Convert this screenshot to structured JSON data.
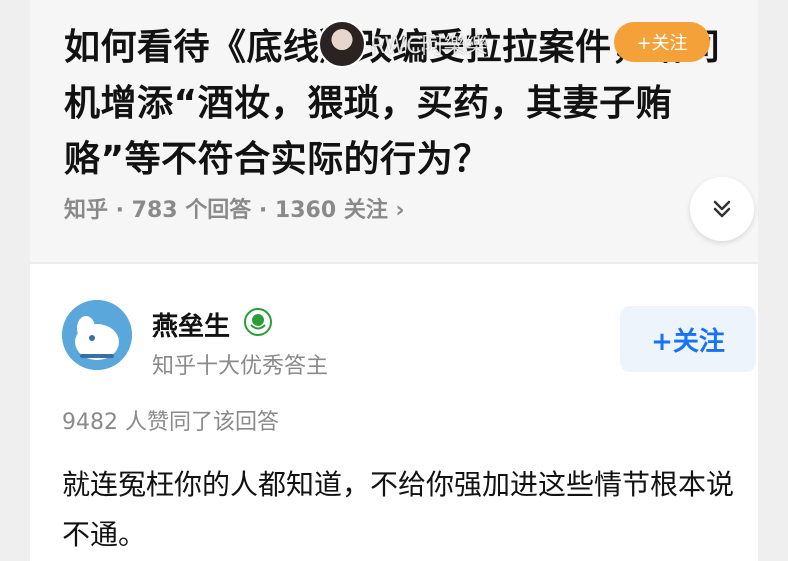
{
  "question": {
    "title": "如何看待《底线》改编受拉拉案件，给司机增添“酒妆，猥琐，买药，其妻子贿赂”等不符合实际的行为？",
    "meta": "知乎 · 783 个回答 · 1360 关注 ›"
  },
  "overlay": {
    "username": "RWC阿樂樂",
    "follow_label": "+关注"
  },
  "answer": {
    "author_name": "燕垒生",
    "author_title": "知乎十大优秀答主",
    "follow_label": "+关注",
    "upvote_text": "9482 人赞同了该回答",
    "body": "就连冤枉你的人都知道，不给你强加进这些情节根本说不通。"
  },
  "icons": {
    "expand": "chevron-double-down-icon",
    "badge": "laurel-badge-icon"
  },
  "colors": {
    "primary_blue": "#1772f6",
    "overlay_orange": "#f5a13a",
    "text": "#121212",
    "meta_gray": "#8a8a8a",
    "badge_green": "#2a9d3a"
  }
}
